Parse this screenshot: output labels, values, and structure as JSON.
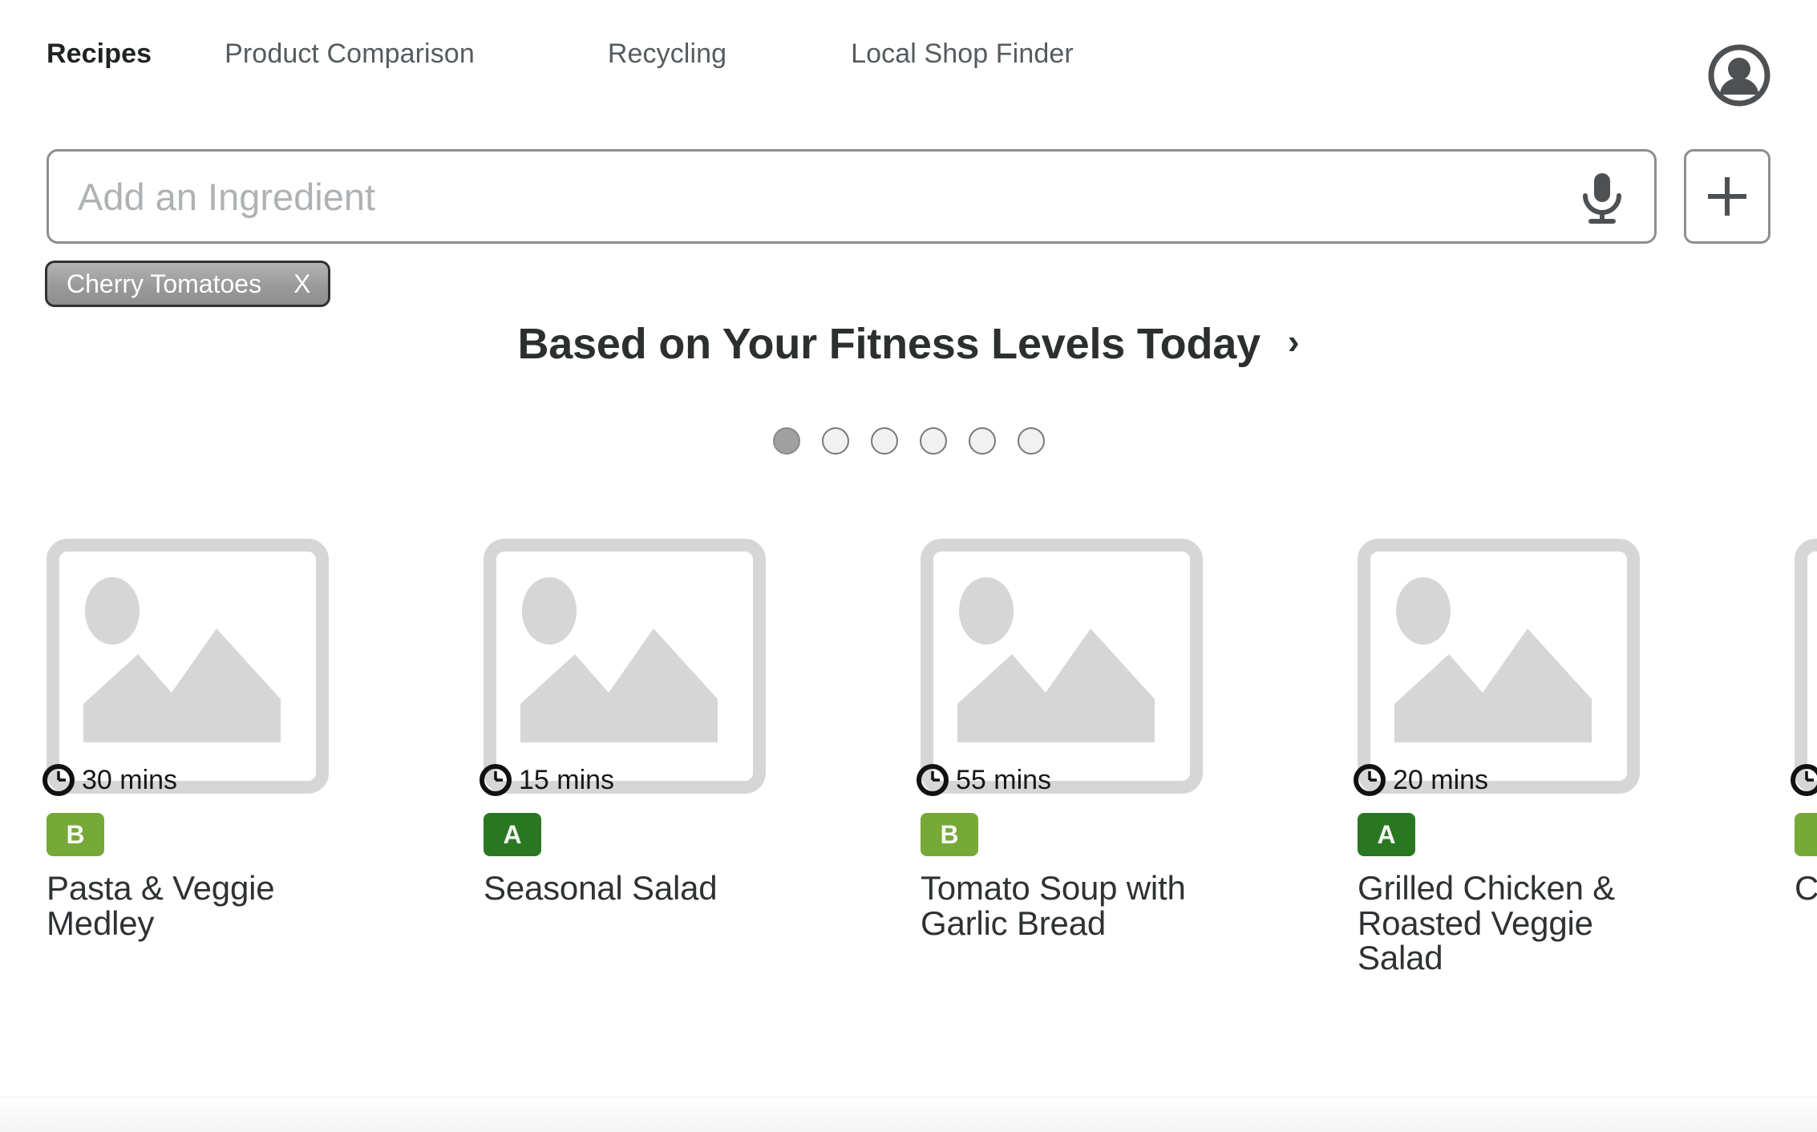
{
  "nav": {
    "items": [
      {
        "label": "Recipes",
        "active": true
      },
      {
        "label": "Product Comparison",
        "active": false
      },
      {
        "label": "Recycling",
        "active": false
      },
      {
        "label": "Local Shop Finder",
        "active": false
      }
    ],
    "avatar_icon": "account-circle-icon"
  },
  "search": {
    "placeholder": "Add an Ingredient",
    "value": "",
    "mic_icon": "microphone-icon",
    "add_icon": "plus-icon"
  },
  "chips": [
    {
      "label": "Cherry Tomatoes",
      "close_label": "X"
    }
  ],
  "section": {
    "title": "Based on Your Fitness Levels Today",
    "chevron": "›"
  },
  "carousel": {
    "total_dots": 6,
    "active_index": 0
  },
  "colors": {
    "grade_a": "#2a7722",
    "grade_b": "#76a938",
    "nav_active": "#1f2324",
    "nav_inactive": "#555b5e",
    "border_gray": "#8b8f91",
    "thumb_gray": "#d6d6d6",
    "dot_active": "#a0a0a0"
  },
  "cards": [
    {
      "time": "30 mins",
      "grade": "B",
      "grade_color": "#76a938",
      "title": "Pasta & Veggie Medley",
      "clock_icon": "clock-icon",
      "image": "image-placeholder-icon"
    },
    {
      "time": "15 mins",
      "grade": "A",
      "grade_color": "#2a7722",
      "title": "Seasonal Salad",
      "clock_icon": "clock-icon",
      "image": "image-placeholder-icon"
    },
    {
      "time": "55 mins",
      "grade": "B",
      "grade_color": "#76a938",
      "title": "Tomato Soup with Garlic Bread",
      "clock_icon": "clock-icon",
      "image": "image-placeholder-icon"
    },
    {
      "time": "20 mins",
      "grade": "A",
      "grade_color": "#2a7722",
      "title": "Grilled Chicken & Roasted Veggie Salad",
      "clock_icon": "clock-icon",
      "image": "image-placeholder-icon"
    },
    {
      "time": "",
      "grade": "",
      "grade_color": "#76a938",
      "title": "C D",
      "clock_icon": "clock-icon",
      "image": "image-placeholder-icon"
    }
  ]
}
